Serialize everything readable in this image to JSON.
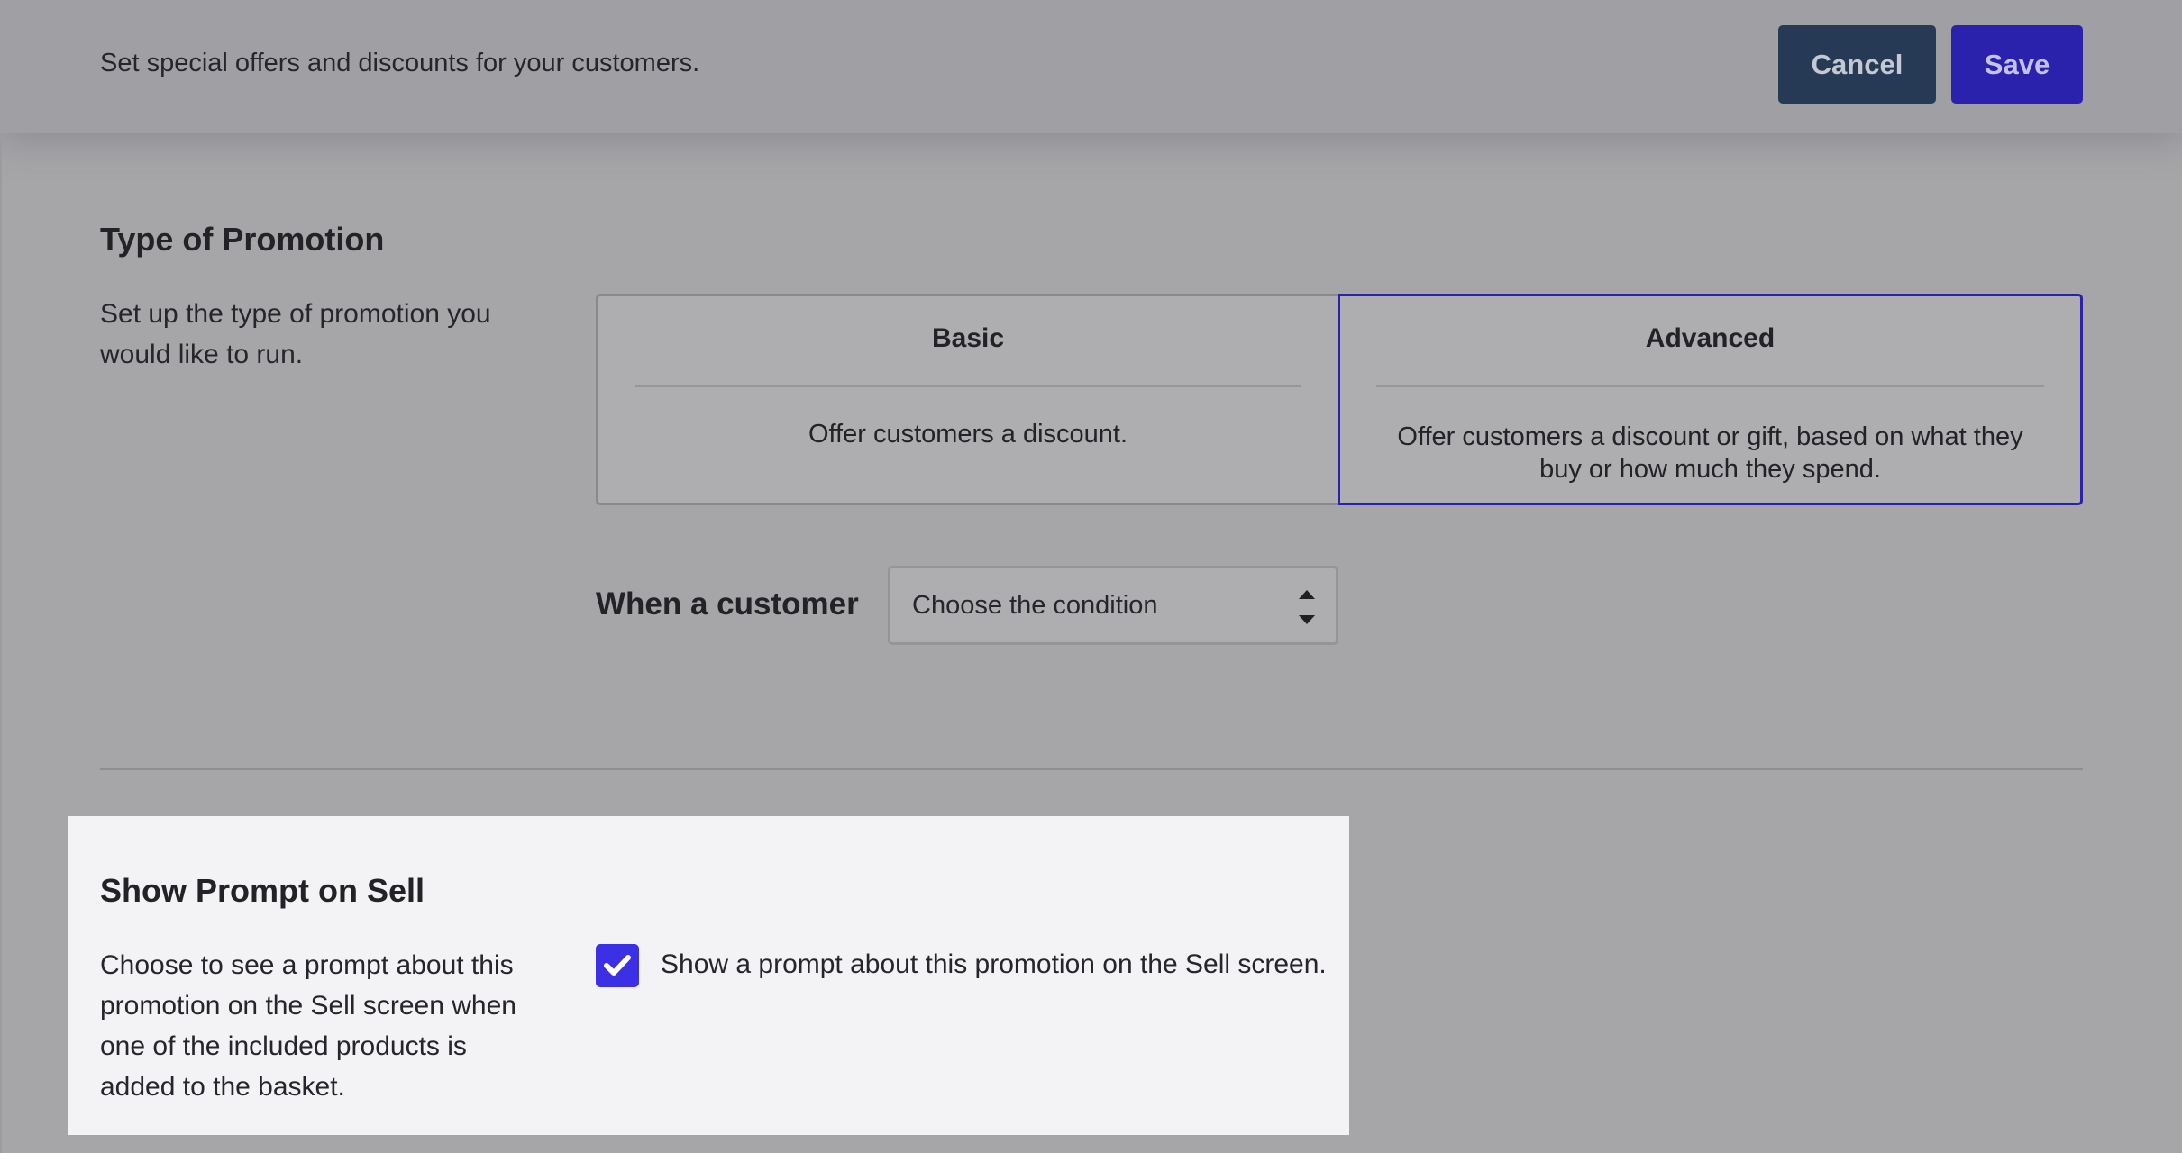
{
  "header": {
    "subtitle": "Set special offers and discounts for your customers.",
    "cancel_label": "Cancel",
    "save_label": "Save"
  },
  "promotion_type": {
    "title": "Type of Promotion",
    "description": "Set up the type of promotion you would like to run.",
    "options": [
      {
        "title": "Basic",
        "text": "Offer customers a discount.",
        "selected": false
      },
      {
        "title": "Advanced",
        "text": "Offer customers a discount or gift, based on what they buy or how much they spend.",
        "selected": true
      }
    ],
    "condition_label": "When a customer",
    "condition_value": "Choose the condition"
  },
  "show_prompt": {
    "title": "Show Prompt on Sell",
    "description": "Choose to see a prompt about this promotion on the Sell screen when one of the included products is added to the basket.",
    "checkbox_label": "Show a prompt about this promotion on the Sell screen.",
    "checked": true
  },
  "colors": {
    "accent": "#3b30e3",
    "save_button": "#2a22ad",
    "cancel_button": "#263a55",
    "selected_border": "#2a22ad"
  },
  "icons": {
    "select_arrows": "sort-arrows-icon",
    "checkbox_check": "checkmark-icon"
  }
}
